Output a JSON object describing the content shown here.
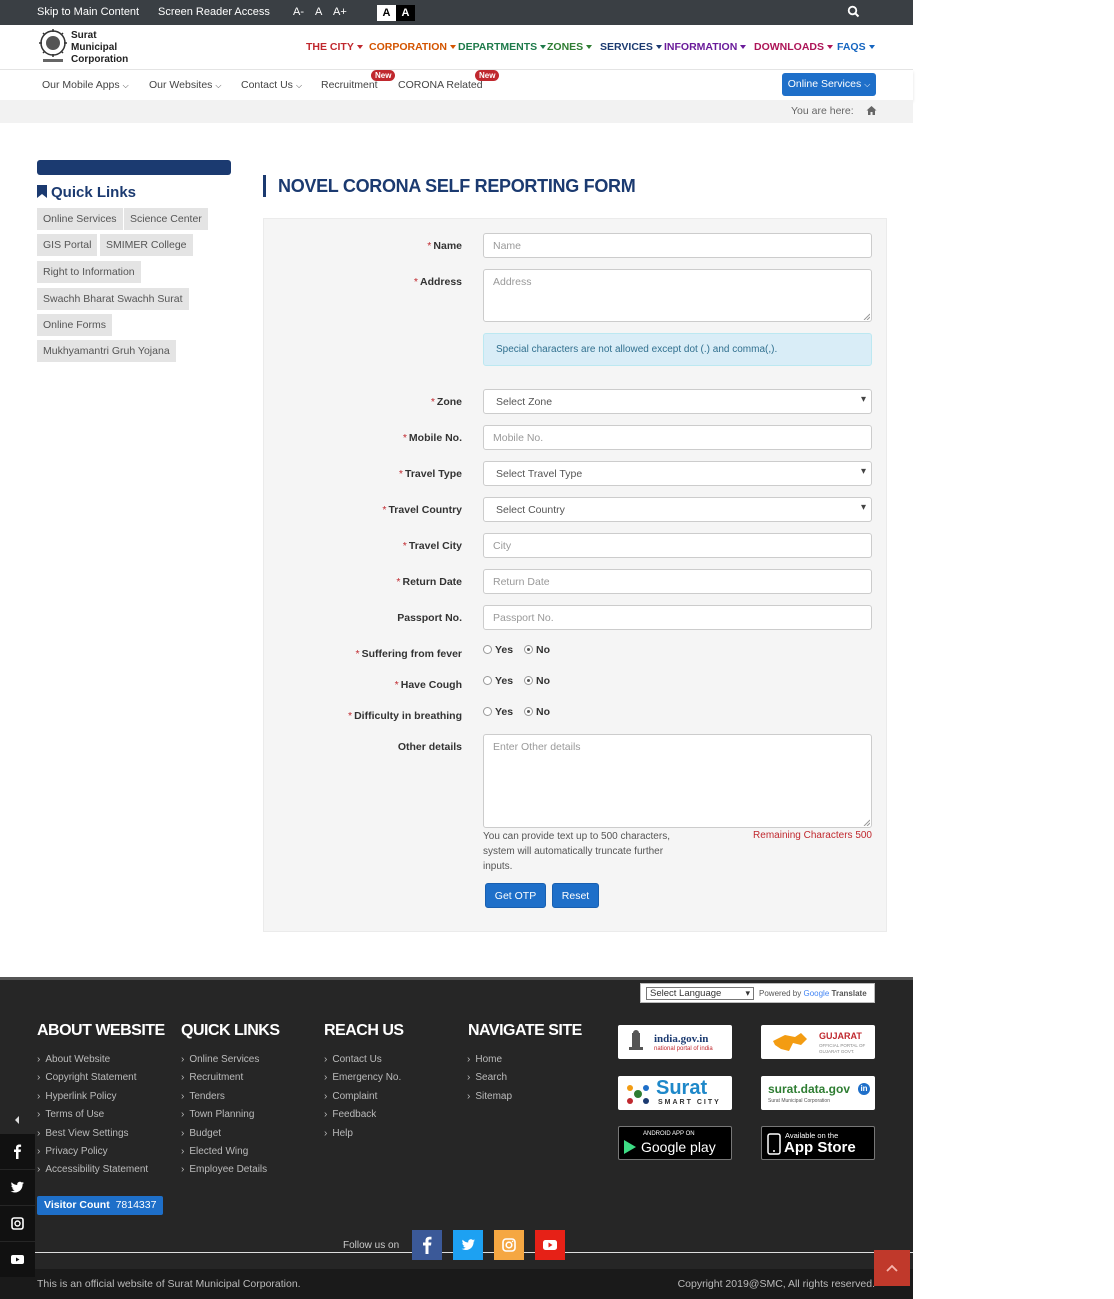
{
  "topbar": {
    "skip": "Skip to Main Content",
    "reader": "Screen Reader Access",
    "font_small": "A-",
    "font_normal": "A",
    "font_large": "A+",
    "contrast_light": "A",
    "contrast_dark": "A"
  },
  "logo": {
    "line1": "Surat",
    "line2": "Municipal",
    "line3": "Corporation"
  },
  "mainnav": [
    {
      "label": "THE CITY",
      "color": "#c0282e"
    },
    {
      "label": "CORPORATION",
      "color": "#d35400"
    },
    {
      "label": "DEPARTMENTS",
      "color": "#1e7a4a"
    },
    {
      "label": "ZONES",
      "color": "#2e7d32"
    },
    {
      "label": "SERVICES",
      "color": "#1b3a70"
    },
    {
      "label": "INFORMATION",
      "color": "#6a1b9a"
    },
    {
      "label": "DOWNLOADS",
      "color": "#ad1457"
    },
    {
      "label": "FAQS",
      "color": "#1565c0"
    }
  ],
  "subnav": {
    "mobile_apps": "Our Mobile Apps",
    "websites": "Our Websites",
    "contact": "Contact Us",
    "recruitment": "Recruitment",
    "corona": "CORONA Related",
    "new_badge": "New",
    "online_services": "Online Services"
  },
  "breadcrumb": {
    "text": "You are here:"
  },
  "quicklinks": {
    "title": "Quick Links",
    "items": [
      "Online Services",
      "Science Center",
      "GIS Portal",
      "SMIMER College",
      "Right to Information",
      "Swachh Bharat Swachh Surat",
      "Online Forms",
      "Mukhyamantri Gruh Yojana"
    ]
  },
  "form": {
    "title": "NOVEL CORONA SELF REPORTING FORM",
    "name_label": "Name",
    "name_ph": "Name",
    "address_label": "Address",
    "address_ph": "Address",
    "info": "Special characters are not allowed except dot (.) and comma(,).",
    "zone_label": "Zone",
    "zone_value": "Select Zone",
    "mobile_label": "Mobile No.",
    "mobile_ph": "Mobile No.",
    "travel_type_label": "Travel Type",
    "travel_type_value": "Select Travel Type",
    "country_label": "Travel Country",
    "country_value": "Select Country",
    "city_label": "Travel City",
    "city_ph": "City",
    "return_label": "Return Date",
    "return_ph": "Return Date",
    "passport_label": "Passport No.",
    "passport_ph": "Passport No.",
    "fever_label": "Suffering from fever",
    "cough_label": "Have Cough",
    "breath_label": "Difficulty in breathing",
    "yes": "Yes",
    "no": "No",
    "other_label": "Other details",
    "other_ph": "Enter Other details",
    "hint": "You can provide text up to 500 characters, system will automatically truncate further inputs.",
    "remaining": "Remaining Characters 500",
    "otp_btn": "Get OTP",
    "reset_btn": "Reset"
  },
  "footer": {
    "lang_select": "Select Language",
    "powered": "Powered by",
    "google": "Google",
    "translate": "Translate",
    "about_title": "ABOUT WEBSITE",
    "about_links": [
      "About Website",
      "Copyright Statement",
      "Hyperlink Policy",
      "Terms of Use",
      "Best View Settings",
      "Privacy Policy",
      "Accessibility Statement"
    ],
    "quick_title": "QUICK LINKS",
    "quick_links": [
      "Online Services",
      "Recruitment",
      "Tenders",
      "Town Planning",
      "Budget",
      "Elected Wing",
      "Employee Details"
    ],
    "reach_title": "REACH US",
    "reach_links": [
      "Contact Us",
      "Emergency No.",
      "Complaint",
      "Feedback",
      "Help"
    ],
    "nav_title": "NAVIGATE SITE",
    "nav_links": [
      "Home",
      "Search",
      "Sitemap"
    ],
    "india_gov": "india.gov.in",
    "india_gov_sub": "national portal of india",
    "gujarat": "GUJARAT",
    "gujarat_sub": "OFFICIAL PORTAL OF GUJARAT GOVT.",
    "surat_smart": "Surat",
    "surat_smart_sub": "SMART CITY",
    "surat_data": "surat.data.gov",
    "surat_data_sub": "Surat Municipal Corporation",
    "android_small": "ANDROID APP ON",
    "android_big": "Google play",
    "ios_small": "Available on the",
    "ios_big": "App Store",
    "visitor_label": "Visitor Count",
    "visitor_count": "7814337",
    "follow": "Follow us on",
    "official": "This is an official website of Surat Municipal Corporation.",
    "copyright": "Copyright 2019@SMC, All rights reserved."
  }
}
